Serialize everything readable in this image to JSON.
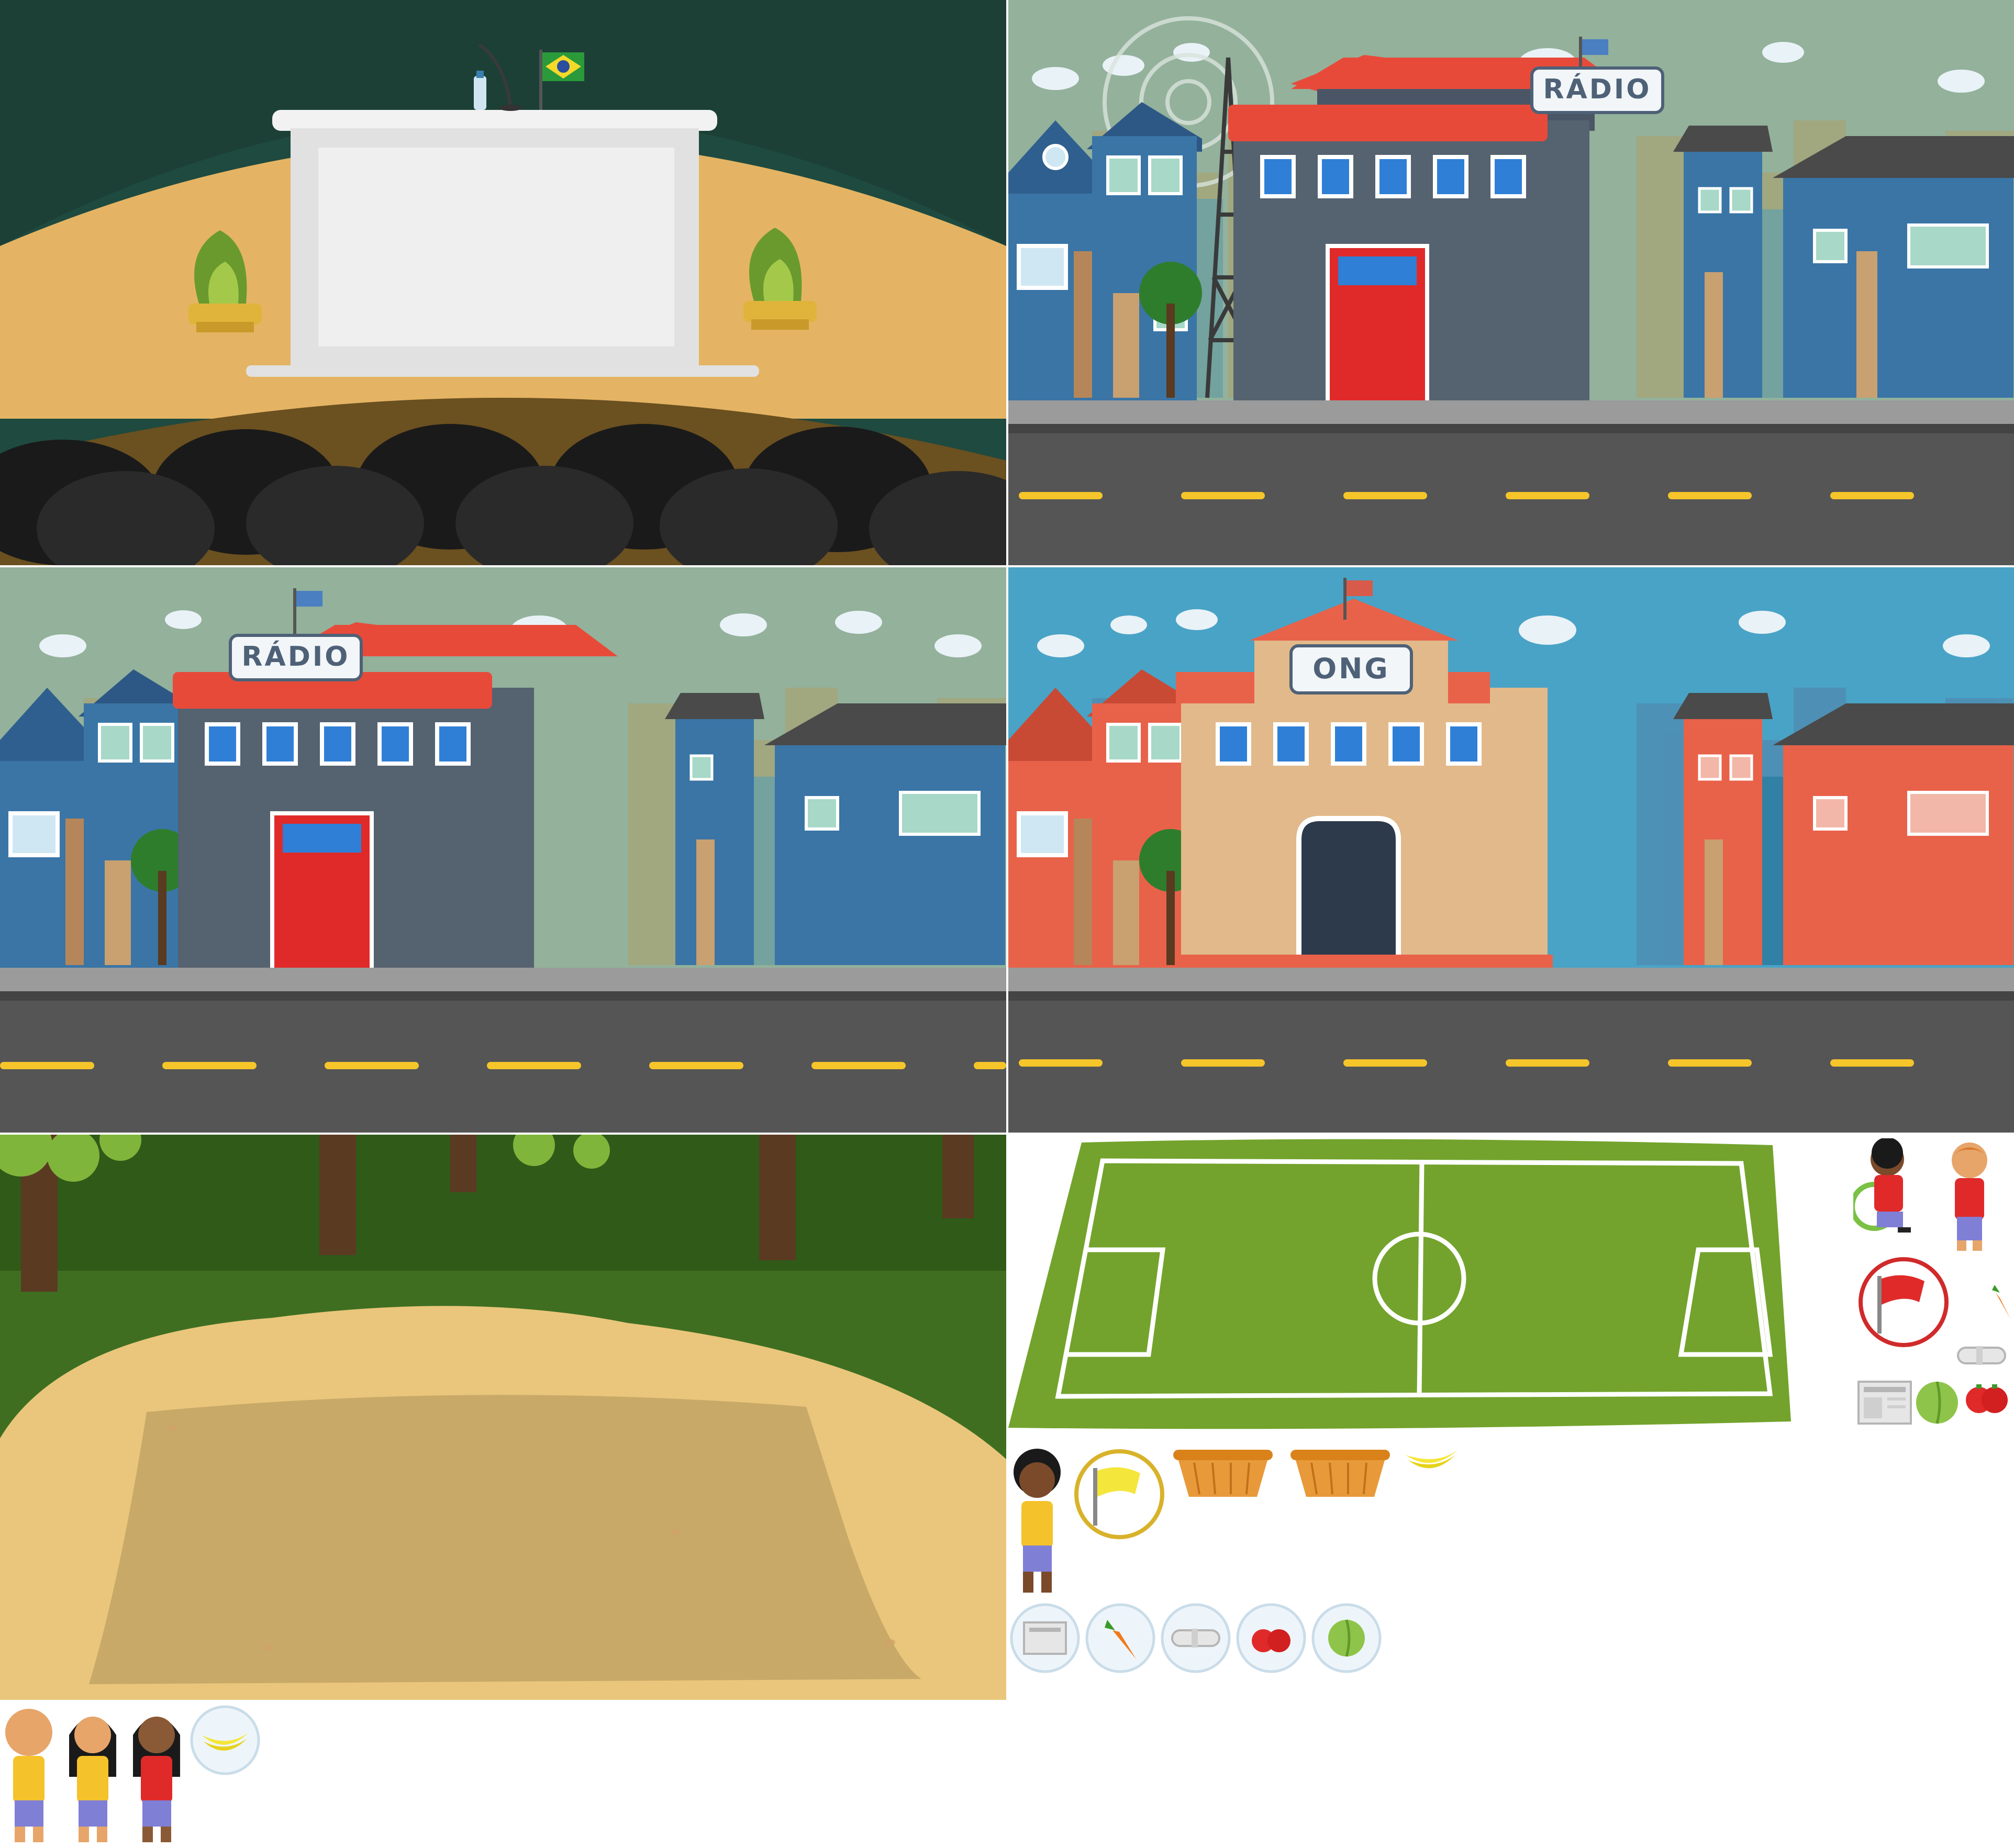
{
  "atlas": {
    "scenes": [
      {
        "id": "auditorium",
        "palette": {
          "wall": "#1f4a3f",
          "floor": "#e4b464",
          "seats": "#1d1d1d"
        }
      },
      {
        "id": "radio-street-broadcast",
        "sign": "RÁDIO",
        "palette": {
          "sky": "#93b19b",
          "house": "#3a75a6",
          "roof": "#e84a3a",
          "road": "#555555",
          "lane": "#f5c52a"
        }
      },
      {
        "id": "radio-street",
        "sign": "RÁDIO",
        "palette": {
          "sky": "#93b19b",
          "house": "#3a75a6",
          "roof": "#e84a3a"
        }
      },
      {
        "id": "ong-street",
        "sign": "ONG",
        "palette": {
          "sky": "#49a3c6",
          "house": "#e8624a",
          "ngo": "#e2b98a",
          "road": "#555555"
        }
      },
      {
        "id": "forest-clearing",
        "palette": {
          "foliage": "#3f6e21",
          "sand": "#e9c67b",
          "trunk": "#5b3a22"
        }
      },
      {
        "id": "soccer-field",
        "palette": {
          "grass": "#73a32c",
          "line": "#ffffff"
        }
      }
    ],
    "sprites": {
      "characters": [
        "boy-wheelchair-icon",
        "boy-red-shirt-icon",
        "girl-yellow-shirt-icon",
        "bald-boy-icon",
        "long-hair-girl-icon",
        "braids-girl-icon"
      ],
      "items": [
        "red-flag-icon",
        "yellow-flag-icon",
        "carrot-icon",
        "newspaper-icon",
        "rolled-newspaper-icon",
        "cabbage-icon",
        "tomatoes-icon",
        "basket-icon",
        "bananas-icon"
      ]
    },
    "flag_colors": {
      "red": "#e02a2a",
      "yellow": "#f4e63a",
      "bubble": "#d9eaf5"
    }
  }
}
